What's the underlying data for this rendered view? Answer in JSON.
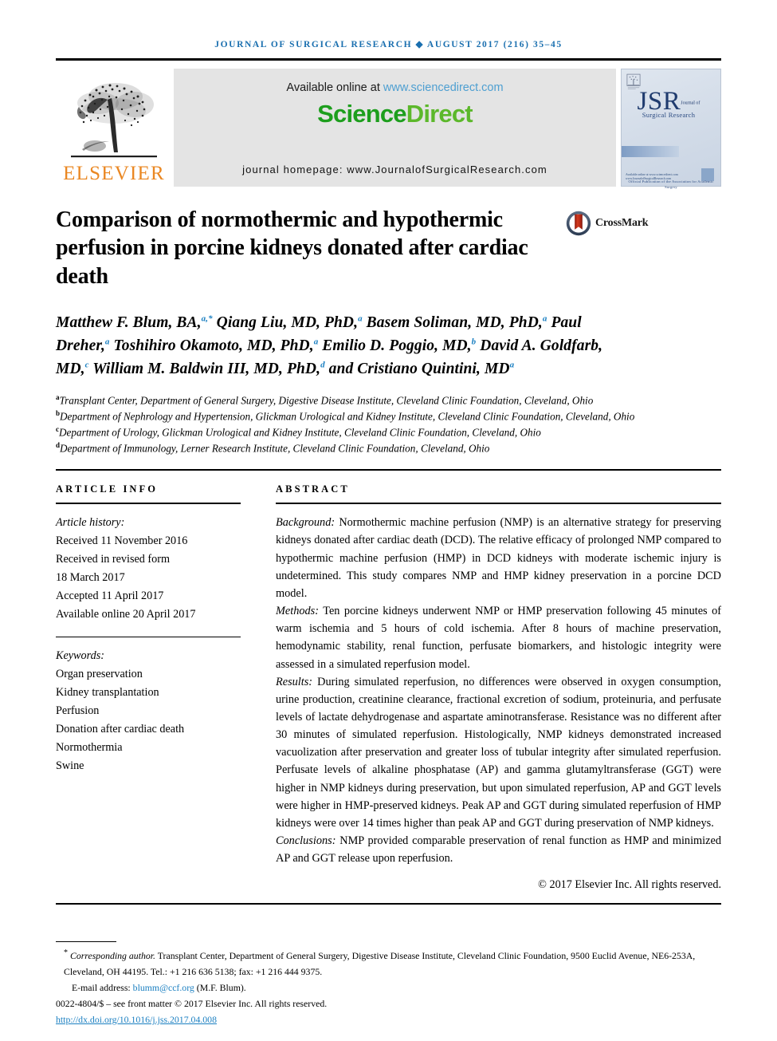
{
  "running_head": "JOURNAL OF SURGICAL RESEARCH ◆ AUGUST 2017 (216) 35–45",
  "masthead": {
    "publisher_name": "ELSEVIER",
    "available_prefix": "Available online at ",
    "sciencedirect_url": "www.sciencedirect.com",
    "brand_head": "Science",
    "brand_tail": "Direct",
    "journal_homepage": "journal homepage: www.JournalofSurgicalResearch.com",
    "cover": {
      "acronym": "JSR",
      "acronym_sup": "Journal of",
      "subtitle": "Surgical Research",
      "association": "Official Publication of the Association for Academic Surgery",
      "footer": "Available online at www.sciencedirect.com\nwww.JournalofSurgicalResearch.com"
    }
  },
  "title": "Comparison of normothermic and hypothermic perfusion in porcine kidneys donated after cardiac death",
  "crossmark_label": "CrossMark",
  "authors_html": "Matthew F. Blum, BA,<sup>a,*</sup> Qiang Liu, MD, PhD,<sup>a</sup> Basem Soliman, MD, PhD,<sup>a</sup> Paul Dreher,<sup>a</sup> Toshihiro Okamoto, MD, PhD,<sup>a</sup> Emilio D. Poggio, MD,<sup>b</sup> David A. Goldfarb, MD,<sup>c</sup> William M. Baldwin III, MD, PhD,<sup>d</sup> and Cristiano Quintini, MD<sup>a</sup>",
  "affiliations": [
    {
      "marker": "a",
      "text": "Transplant Center, Department of General Surgery, Digestive Disease Institute, Cleveland Clinic Foundation, Cleveland, Ohio"
    },
    {
      "marker": "b",
      "text": "Department of Nephrology and Hypertension, Glickman Urological and Kidney Institute, Cleveland Clinic Foundation, Cleveland, Ohio"
    },
    {
      "marker": "c",
      "text": "Department of Urology, Glickman Urological and Kidney Institute, Cleveland Clinic Foundation, Cleveland, Ohio"
    },
    {
      "marker": "d",
      "text": "Department of Immunology, Lerner Research Institute, Cleveland Clinic Foundation, Cleveland, Ohio"
    }
  ],
  "article_info": {
    "heading": "ARTICLE INFO",
    "history_label": "Article history:",
    "history": [
      "Received 11 November 2016",
      "Received in revised form",
      "18 March 2017",
      "Accepted 11 April 2017",
      "Available online 20 April 2017"
    ],
    "keywords_label": "Keywords:",
    "keywords": [
      "Organ preservation",
      "Kidney transplantation",
      "Perfusion",
      "Donation after cardiac death",
      "Normothermia",
      "Swine"
    ]
  },
  "abstract": {
    "heading": "ABSTRACT",
    "background_label": "Background:",
    "background_text": " Normothermic machine perfusion (NMP) is an alternative strategy for preserving kidneys donated after cardiac death (DCD). The relative efficacy of prolonged NMP compared to hypothermic machine perfusion (HMP) in DCD kidneys with moderate ischemic injury is undetermined. This study compares NMP and HMP kidney preservation in a porcine DCD model.",
    "methods_label": "Methods:",
    "methods_text": " Ten porcine kidneys underwent NMP or HMP preservation following 45 minutes of warm ischemia and 5 hours of cold ischemia. After 8 hours of machine preservation, hemodynamic stability, renal function, perfusate biomarkers, and histologic integrity were assessed in a simulated reperfusion model.",
    "results_label": "Results:",
    "results_text": " During simulated reperfusion, no differences were observed in oxygen consumption, urine production, creatinine clearance, fractional excretion of sodium, proteinuria, and perfusate levels of lactate dehydrogenase and aspartate aminotransferase. Resistance was no different after 30 minutes of simulated reperfusion. Histologically, NMP kidneys demonstrated increased vacuolization after preservation and greater loss of tubular integrity after simulated reperfusion. Perfusate levels of alkaline phosphatase (AP) and gamma glutamyltransferase (GGT) were higher in NMP kidneys during preservation, but upon simulated reperfusion, AP and GGT levels were higher in HMP-preserved kidneys. Peak AP and GGT during simulated reperfusion of HMP kidneys were over 14 times higher than peak AP and GGT during preservation of NMP kidneys.",
    "conclusions_label": "Conclusions:",
    "conclusions_text": " NMP provided comparable preservation of renal function as HMP and minimized AP and GGT release upon reperfusion.",
    "copyright": "© 2017 Elsevier Inc. All rights reserved."
  },
  "footer": {
    "corresponding_label": "Corresponding author.",
    "corresponding_text": " Transplant Center, Department of General Surgery, Digestive Disease Institute, Cleveland Clinic Foundation, 9500 Euclid Avenue, NE6-253A, Cleveland, OH 44195. Tel.: +1 216 636 5138; fax: +1 216 444 9375.",
    "email_label": "E-mail address:",
    "email": "blumm@ccf.org",
    "email_suffix": " (M.F. Blum).",
    "issn_line": "0022-4804/$ – see front matter © 2017 Elsevier Inc. All rights reserved.",
    "doi": "http://dx.doi.org/10.1016/j.jss.2017.04.008"
  },
  "colors": {
    "running_head_blue": "#1a6faf",
    "elsevier_orange": "#ea8722",
    "sciencedirect_green": "#1d9e1d",
    "link_blue": "#1a7fc1",
    "sd_box_gray": "#e4e4e4",
    "crossmark_red": "#c02a1c"
  }
}
